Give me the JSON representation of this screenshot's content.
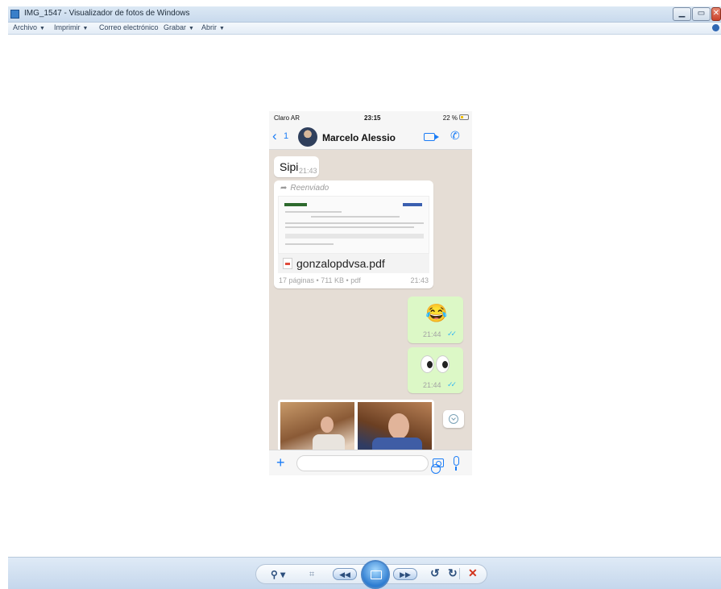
{
  "window": {
    "title": "IMG_1547 - Visualizador de fotos de Windows",
    "buttons": {
      "minimize": "▁",
      "maximize": "▭",
      "close": "✕"
    }
  },
  "menu": {
    "items": [
      {
        "label": "Archivo"
      },
      {
        "label": "Imprimir"
      },
      {
        "label": "Correo electrónico"
      },
      {
        "label": "Grabar"
      },
      {
        "label": "Abrir"
      }
    ],
    "caret": "▼"
  },
  "phone": {
    "status": {
      "carrier": "Claro AR",
      "time": "23:15",
      "battery": "22 %"
    },
    "header": {
      "back_glyph": "‹",
      "back_count": "1",
      "contact_name": "Marcelo Alessio",
      "call_glyph": "✆"
    },
    "messages": {
      "m1": {
        "text": "Sipi",
        "time": "21:43"
      },
      "m2": {
        "forwarded_arrow": "➦",
        "forwarded_label": "Reenviado",
        "file_name": "gonzalopdvsa.pdf",
        "file_meta": "17 páginas • 711 KB • pdf",
        "time": "21:43"
      },
      "m3": {
        "emoji": "😂",
        "time": "21:44",
        "ticks": "✓✓"
      },
      "m4": {
        "time": "21:44",
        "ticks": "✓✓"
      }
    },
    "composer": {
      "plus": "+"
    }
  },
  "toolbar": {
    "zoom": "⚲ ▾",
    "fit": "⌗",
    "prev": "◀◀",
    "next": "▶▶",
    "rotate_left": "↺",
    "rotate_right": "↻",
    "delete": "✕"
  }
}
